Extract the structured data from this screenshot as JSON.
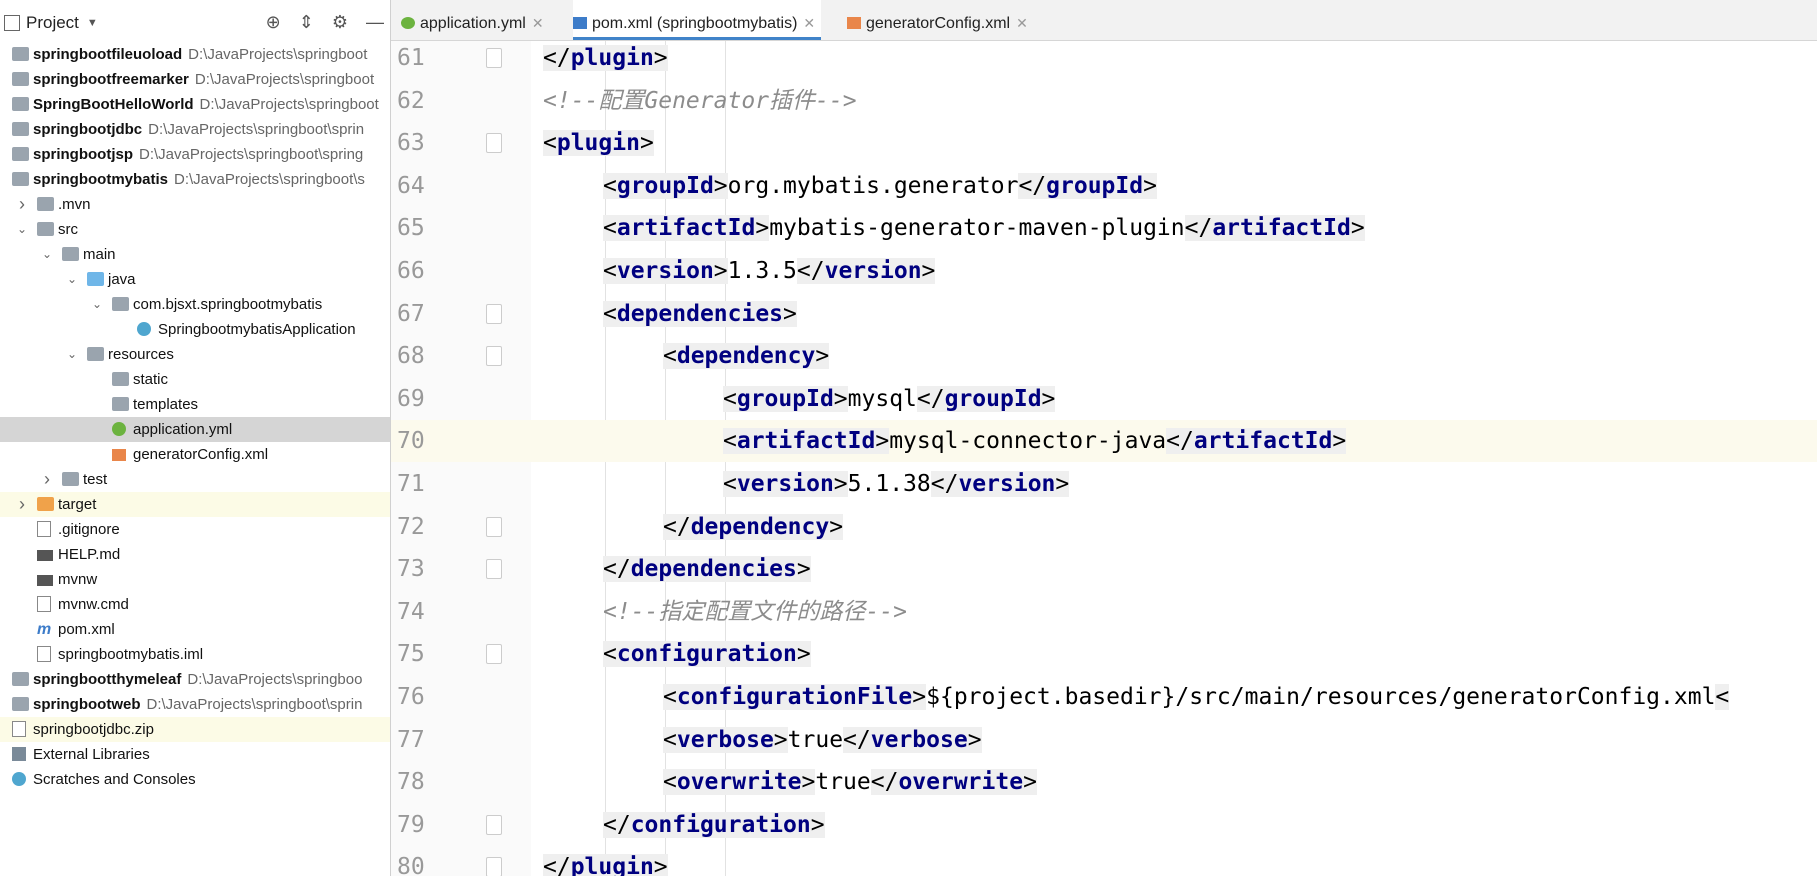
{
  "project_panel": {
    "title": "Project",
    "tree": [
      {
        "label": "springbootfileuoload",
        "path": "D:\\JavaProjects\\springboot",
        "bold": true,
        "icon": "module-icon",
        "depth": 0
      },
      {
        "label": "springbootfreemarker",
        "path": "D:\\JavaProjects\\springboot",
        "bold": true,
        "icon": "module-icon",
        "depth": 0
      },
      {
        "label": "SpringBootHelloWorld",
        "path": "D:\\JavaProjects\\springboot",
        "bold": true,
        "icon": "module-icon",
        "depth": 0
      },
      {
        "label": "springbootjdbc",
        "path": "D:\\JavaProjects\\springboot\\sprin",
        "bold": true,
        "icon": "module-icon",
        "depth": 0
      },
      {
        "label": "springbootjsp",
        "path": "D:\\JavaProjects\\springboot\\spring",
        "bold": true,
        "icon": "module-icon",
        "depth": 0
      },
      {
        "label": "springbootmybatis",
        "path": "D:\\JavaProjects\\springboot\\s",
        "bold": true,
        "icon": "module-icon",
        "depth": 0
      },
      {
        "label": ".mvn",
        "path": "",
        "bold": false,
        "icon": "folder-icon",
        "depth": 1,
        "arrow": "right"
      },
      {
        "label": "src",
        "path": "",
        "bold": false,
        "icon": "folder-icon",
        "depth": 1,
        "arrow": "down"
      },
      {
        "label": "main",
        "path": "",
        "bold": false,
        "icon": "folder-icon",
        "depth": 2,
        "arrow": "down"
      },
      {
        "label": "java",
        "path": "",
        "bold": false,
        "icon": "source-folder-icon",
        "depth": 3,
        "arrow": "down"
      },
      {
        "label": "com.bjsxt.springbootmybatis",
        "path": "",
        "bold": false,
        "icon": "package-icon",
        "depth": 4,
        "arrow": "down"
      },
      {
        "label": "SpringbootmybatisApplication",
        "path": "",
        "bold": false,
        "icon": "spring-class-icon",
        "depth": 5
      },
      {
        "label": "resources",
        "path": "",
        "bold": false,
        "icon": "resources-folder-icon",
        "depth": 3,
        "arrow": "down"
      },
      {
        "label": "static",
        "path": "",
        "bold": false,
        "icon": "folder-icon",
        "depth": 4
      },
      {
        "label": "templates",
        "path": "",
        "bold": false,
        "icon": "folder-icon",
        "depth": 4
      },
      {
        "label": "application.yml",
        "path": "",
        "bold": false,
        "icon": "yml-icon",
        "depth": 4,
        "selected": true
      },
      {
        "label": "generatorConfig.xml",
        "path": "",
        "bold": false,
        "icon": "xml-icon",
        "depth": 4
      },
      {
        "label": "test",
        "path": "",
        "bold": false,
        "icon": "folder-icon",
        "depth": 2,
        "arrow": "right"
      },
      {
        "label": "target",
        "path": "",
        "bold": false,
        "icon": "excluded-folder-icon",
        "depth": 1,
        "arrow": "right",
        "highlight": true
      },
      {
        "label": ".gitignore",
        "path": "",
        "bold": false,
        "icon": "text-file-icon",
        "depth": 1
      },
      {
        "label": "HELP.md",
        "path": "",
        "bold": false,
        "icon": "markdown-icon",
        "depth": 1
      },
      {
        "label": "mvnw",
        "path": "",
        "bold": false,
        "icon": "script-icon",
        "depth": 1
      },
      {
        "label": "mvnw.cmd",
        "path": "",
        "bold": false,
        "icon": "cmd-file-icon",
        "depth": 1
      },
      {
        "label": "pom.xml",
        "path": "",
        "bold": false,
        "icon": "maven-icon",
        "depth": 1
      },
      {
        "label": "springbootmybatis.iml",
        "path": "",
        "bold": false,
        "icon": "iml-file-icon",
        "depth": 1
      },
      {
        "label": "springbootthymeleaf",
        "path": "D:\\JavaProjects\\springboo",
        "bold": true,
        "icon": "module-icon",
        "depth": 0
      },
      {
        "label": "springbootweb",
        "path": "D:\\JavaProjects\\springboot\\sprin",
        "bold": true,
        "icon": "module-icon",
        "depth": 0
      },
      {
        "label": "springbootjdbc.zip",
        "path": "",
        "bold": false,
        "icon": "zip-icon",
        "depth": 0,
        "highlight": true
      },
      {
        "label": "External Libraries",
        "path": "",
        "bold": false,
        "icon": "libraries-icon",
        "depth": 0
      },
      {
        "label": "Scratches and Consoles",
        "path": "",
        "bold": false,
        "icon": "scratches-icon",
        "depth": 0
      }
    ]
  },
  "tabs": [
    {
      "label": "application.yml",
      "icon": "yml-icon",
      "active": false
    },
    {
      "label": "pom.xml (springbootmybatis)",
      "icon": "maven-icon",
      "active": true
    },
    {
      "label": "generatorConfig.xml",
      "icon": "xml-icon",
      "active": false
    }
  ],
  "editor": {
    "current_line": 70,
    "lines": [
      {
        "n": "61",
        "indent": 1,
        "kind": "close",
        "tag": "plugin",
        "fold": true
      },
      {
        "n": "62",
        "indent": 1,
        "kind": "comment",
        "text": "<!--配置Generator插件-->"
      },
      {
        "n": "63",
        "indent": 1,
        "kind": "open",
        "tag": "plugin",
        "fold": true
      },
      {
        "n": "64",
        "indent": 2,
        "kind": "el",
        "tag": "groupId",
        "text": "org.mybatis.generator"
      },
      {
        "n": "65",
        "indent": 2,
        "kind": "el",
        "tag": "artifactId",
        "text": "mybatis-generator-maven-plugin"
      },
      {
        "n": "66",
        "indent": 2,
        "kind": "el",
        "tag": "version",
        "text": "1.3.5"
      },
      {
        "n": "67",
        "indent": 2,
        "kind": "open",
        "tag": "dependencies",
        "fold": true
      },
      {
        "n": "68",
        "indent": 3,
        "kind": "open",
        "tag": "dependency",
        "fold": true
      },
      {
        "n": "69",
        "indent": 4,
        "kind": "el",
        "tag": "groupId",
        "text": "mysql"
      },
      {
        "n": "70",
        "indent": 4,
        "kind": "el",
        "tag": "artifactId",
        "text": "mysql-connector-java"
      },
      {
        "n": "71",
        "indent": 4,
        "kind": "el",
        "tag": "version",
        "text": "5.1.38"
      },
      {
        "n": "72",
        "indent": 3,
        "kind": "close",
        "tag": "dependency",
        "fold": true
      },
      {
        "n": "73",
        "indent": 2,
        "kind": "close",
        "tag": "dependencies",
        "fold": true
      },
      {
        "n": "74",
        "indent": 2,
        "kind": "comment",
        "text": "<!--指定配置文件的路径-->"
      },
      {
        "n": "75",
        "indent": 2,
        "kind": "open",
        "tag": "configuration",
        "fold": true
      },
      {
        "n": "76",
        "indent": 3,
        "kind": "el",
        "tag": "configurationFile",
        "text": "${project.basedir}/src/main/resources/generatorConfig.xml",
        "trunc": "<"
      },
      {
        "n": "77",
        "indent": 3,
        "kind": "el",
        "tag": "verbose",
        "text": "true"
      },
      {
        "n": "78",
        "indent": 3,
        "kind": "el",
        "tag": "overwrite",
        "text": "true"
      },
      {
        "n": "79",
        "indent": 2,
        "kind": "close",
        "tag": "configuration",
        "fold": true
      },
      {
        "n": "80",
        "indent": 1,
        "kind": "close",
        "tag": "plugin",
        "fold": true
      }
    ]
  },
  "colors": {
    "tag": "#000080",
    "comment": "#8c8c8c",
    "selection": "#d5d5d5",
    "active_tab": "#4083c9",
    "current_line": "#fcfaed"
  }
}
